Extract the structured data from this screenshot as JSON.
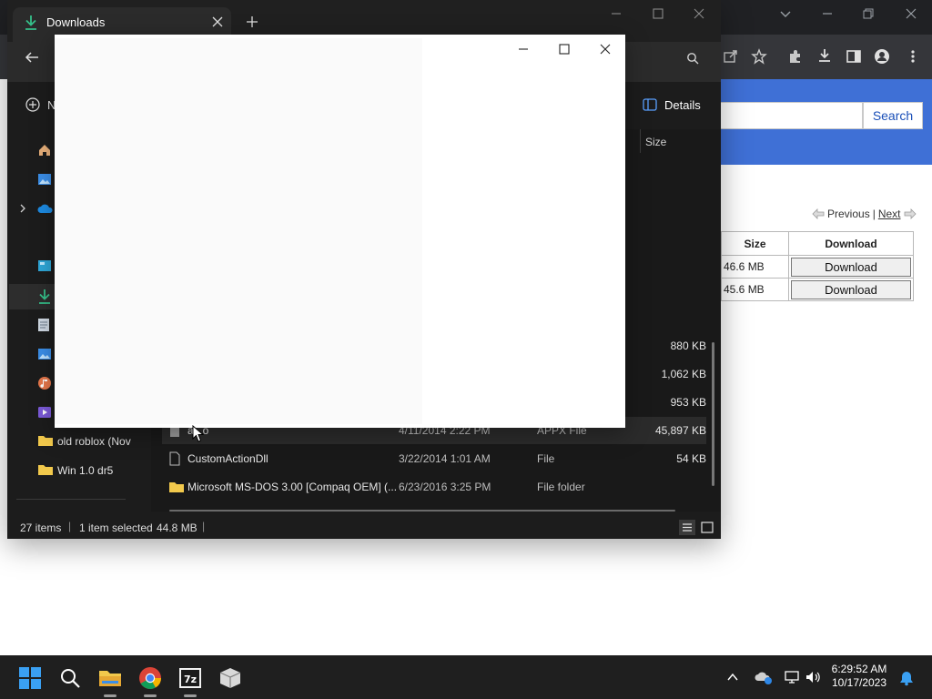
{
  "browser": {
    "search_button": "Search",
    "pager": {
      "previous": "Previous",
      "separator": "|",
      "next": "Next"
    },
    "table": {
      "headers": [
        "Size",
        "Download"
      ],
      "rows": [
        {
          "size": "46.6 MB",
          "action": "Download"
        },
        {
          "size": "45.6 MB",
          "action": "Download"
        }
      ]
    }
  },
  "explorer": {
    "tab_title": "Downloads",
    "new_button_partial": "N",
    "details_label": "Details",
    "column_size": "Size",
    "nav": {
      "folders": [
        {
          "label": "old roblox (Nov"
        },
        {
          "label": "Win 1.0 dr5"
        }
      ]
    },
    "files": {
      "sizes_only": [
        "880 KB",
        "1,062 KB",
        "953 KB"
      ],
      "rows": [
        {
          "name": "a...o",
          "date": "4/11/2014 2:22 PM",
          "type": "APPX File",
          "size": "45,897 KB",
          "icon": "file-icon"
        },
        {
          "name": "CustomActionDll",
          "date": "3/22/2014 1:01 AM",
          "type": "File",
          "size": "54 KB",
          "icon": "file-icon"
        },
        {
          "name": "Microsoft MS-DOS 3.00 [Compaq OEM] (...",
          "date": "6/23/2016 3:25 PM",
          "type": "File folder",
          "size": "",
          "icon": "folder-icon"
        }
      ]
    },
    "status": {
      "item_count": "27 items",
      "selected": "1 item selected",
      "selected_size": "44.8 MB"
    }
  },
  "taskbar": {
    "time": "6:29:52 AM",
    "date": "10/17/2023"
  },
  "colors": {
    "explorer_bg": "#1c1c1c",
    "site_header": "#3f70d6",
    "downloads_accent": "#35c08a"
  }
}
